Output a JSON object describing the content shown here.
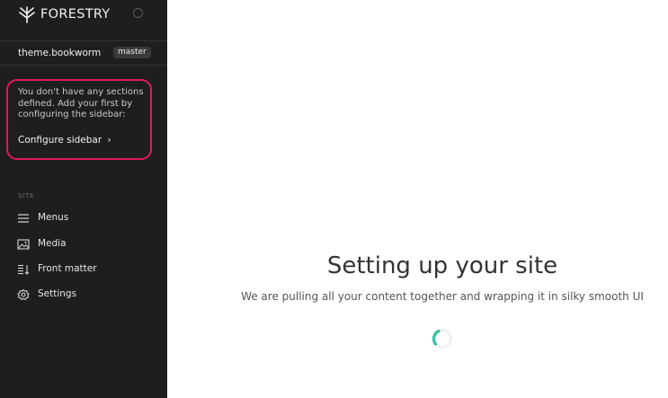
{
  "brand": {
    "name": "FORESTRY"
  },
  "repo": {
    "name": "theme.bookworm",
    "branch": "master"
  },
  "notice": {
    "text": "You don't have any sections defined. Add your first by configuring the sidebar:",
    "link_label": "Configure sidebar",
    "link_arrow": "›",
    "highlight_color": "#e0185f"
  },
  "sidebar": {
    "section_label": "SITE",
    "items": [
      {
        "label": "Menus",
        "icon": "menu-lines-icon"
      },
      {
        "label": "Media",
        "icon": "image-icon"
      },
      {
        "label": "Front matter",
        "icon": "sort-list-icon"
      },
      {
        "label": "Settings",
        "icon": "gear-icon"
      }
    ]
  },
  "main": {
    "title": "Setting up your site",
    "subtitle": "We are pulling all your content together and wrapping it in silky smooth UI",
    "spinner_color": "#2ec4a0"
  }
}
